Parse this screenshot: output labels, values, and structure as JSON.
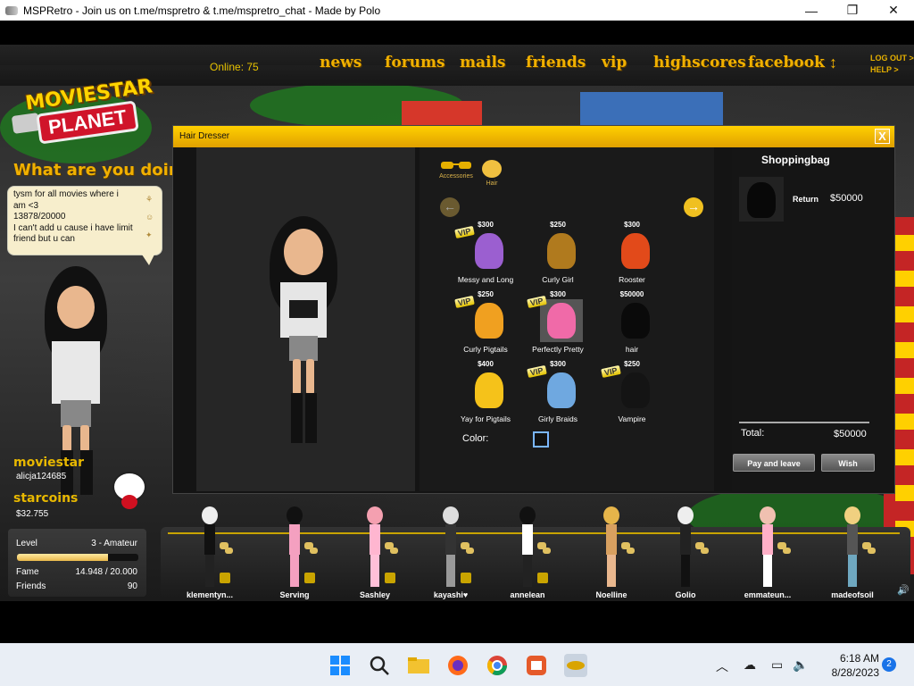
{
  "window": {
    "title": "MSPRetro - Join us on t.me/mspretro & t.me/mspretro_chat - Made by Polo",
    "minimize": "—",
    "maximize": "❐",
    "close": "✕"
  },
  "nav": {
    "online": "Online: 75",
    "links": [
      "news",
      "forums",
      "mails",
      "friends",
      "vip",
      "highscores",
      "facebook"
    ],
    "logout": "LOG OUT >",
    "help": "HELP >"
  },
  "logo": {
    "line1": "MOVIESTAR",
    "line2": "PLANET"
  },
  "sidebar": {
    "what_doing": "What are you doing?",
    "status_lines": [
      "tysm for all movies where i",
      "am <3",
      "13878/20000",
      "I can't add u cause i have limit",
      "friend but u can"
    ],
    "moviestar_label": "moviestar",
    "username": "alicja124685",
    "starcoins_label": "starcoins",
    "starcoins_value": "$32.755"
  },
  "level": {
    "level_label": "Level",
    "level_value": "3 - Amateur",
    "level_progress": 0.75,
    "fame_label": "Fame",
    "fame_value": "14.948 / 20.000",
    "friends_label": "Friends",
    "friends_value": "90"
  },
  "dialog": {
    "title": "Hair Dresser",
    "close": "X",
    "categories": [
      {
        "label": "Accessories",
        "icon": "sunglasses-icon"
      },
      {
        "label": "Hair",
        "icon": "hair-icon"
      }
    ],
    "items": [
      {
        "name": "Messy and Long",
        "price": "$300",
        "vip": true,
        "color": "#9b5fd0"
      },
      {
        "name": "Curly Girl",
        "price": "$250",
        "vip": false,
        "color": "#b07a1e"
      },
      {
        "name": "Rooster",
        "price": "$300",
        "vip": false,
        "color": "#e24a1a"
      },
      {
        "name": "Curly Pigtails",
        "price": "$250",
        "vip": true,
        "color": "#f0a020"
      },
      {
        "name": "Perfectly Pretty",
        "price": "$300",
        "vip": true,
        "color": "#f06aa8"
      },
      {
        "name": "hair",
        "price": "$50000",
        "vip": false,
        "color": "#0a0a0a"
      },
      {
        "name": "Yay for Pigtails",
        "price": "$400",
        "vip": false,
        "color": "#f5c21a"
      },
      {
        "name": "Girly Braids",
        "price": "$300",
        "vip": true,
        "color": "#6fa8e0"
      },
      {
        "name": "Vampire",
        "price": "$250",
        "vip": true,
        "color": "#141414"
      }
    ],
    "vip_badge": "VIP",
    "color_label": "Color:",
    "shoppingbag": {
      "title": "Shoppingbag",
      "item_name": "Return",
      "item_price": "$50000",
      "total_label": "Total:",
      "total_value": "$50000",
      "pay_button": "Pay and leave",
      "wish_button": "Wish"
    }
  },
  "friends": [
    {
      "name": "klementyn...",
      "hair": "#eee",
      "top": "#111",
      "legs": "#222"
    },
    {
      "name": "Serving",
      "hair": "#111",
      "top": "#f4a0c0",
      "legs": "#f4a0c0"
    },
    {
      "name": "Sashley",
      "hair": "#f4a0b0",
      "top": "#ffb6d0",
      "legs": "#ffc0d8"
    },
    {
      "name": "kayashi♥",
      "hair": "#ddd",
      "top": "#333",
      "legs": "#999"
    },
    {
      "name": "annelean",
      "hair": "#111",
      "top": "#fff",
      "legs": "#222"
    },
    {
      "name": "Noelline",
      "hair": "#e6b54a",
      "top": "#d8a060",
      "legs": "#e9b78e"
    },
    {
      "name": "Golio",
      "hair": "#eee",
      "top": "#222",
      "legs": "#111"
    },
    {
      "name": "emmateun...",
      "hair": "#f0c0b0",
      "top": "#ffb0c8",
      "legs": "#fff"
    },
    {
      "name": "madeofsoil",
      "hair": "#f0d080",
      "top": "#555",
      "legs": "#6fa8c0"
    }
  ],
  "taskbar": {
    "time": "6:18 AM",
    "date": "8/28/2023",
    "notifications": "2",
    "icons": [
      "windows-start-icon",
      "search-icon",
      "file-explorer-icon",
      "firefox-icon",
      "chrome-icon",
      "app-icon",
      "mspretro-icon"
    ]
  }
}
